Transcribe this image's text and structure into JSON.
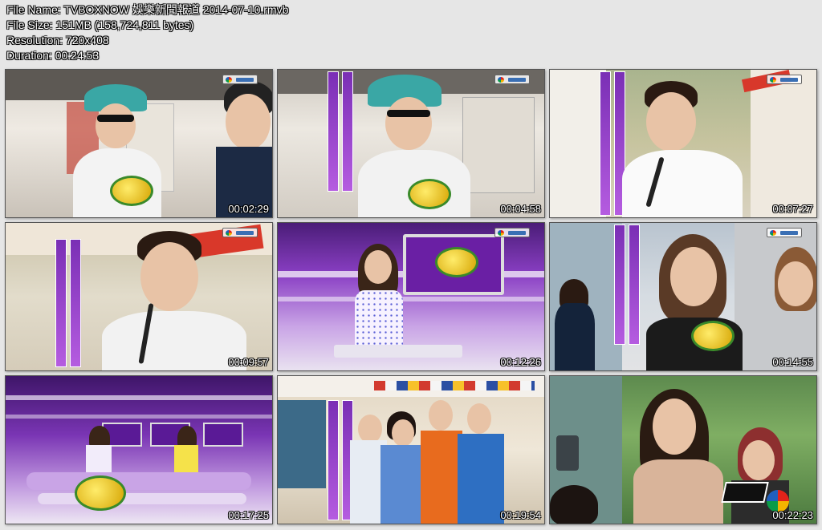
{
  "header": {
    "file_name": "File Name: TVBOXNOW 娛樂新聞報道 2014-07-10.rmvb",
    "file_size": "File Size: 151MB (158,724,811 bytes)",
    "resolution": "Resolution: 720x408",
    "duration": "Duration: 00:24:53"
  },
  "thumbnails": [
    {
      "timestamp": "00:02:29"
    },
    {
      "timestamp": "00:04:58"
    },
    {
      "timestamp": "00:07:27"
    },
    {
      "timestamp": "00:09:57"
    },
    {
      "timestamp": "00:12:26"
    },
    {
      "timestamp": "00:14:55"
    },
    {
      "timestamp": "00:17:25"
    },
    {
      "timestamp": "00:19:54"
    },
    {
      "timestamp": "00:22:23"
    }
  ],
  "colors": {
    "background": "#e6e6e6",
    "brand_purple": "#8a3fc4",
    "timestamp_text": "#ffffff"
  },
  "icons": [
    "tvb-channel-logo-icon",
    "show-logo-icon"
  ]
}
